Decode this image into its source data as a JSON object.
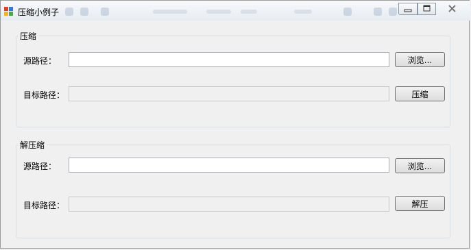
{
  "window": {
    "title": "压缩小例子",
    "controls": {
      "minimize": "minimize-button",
      "restore": "restore-button",
      "close": "close-button"
    }
  },
  "compress": {
    "group_title": "压缩",
    "source_label": "源路径：",
    "source_value": "",
    "browse_label": "浏览...",
    "target_label": "目标路径：",
    "target_value": "",
    "action_label": "压缩"
  },
  "decompress": {
    "group_title": "解压缩",
    "source_label": "源路径：",
    "source_value": "",
    "browse_label": "浏览...",
    "target_label": "目标路径：",
    "target_value": "",
    "action_label": "解压"
  },
  "icons": {
    "app": "app-icon",
    "minimize": "minimize-icon",
    "restore": "restore-icon",
    "close": "close-icon"
  }
}
